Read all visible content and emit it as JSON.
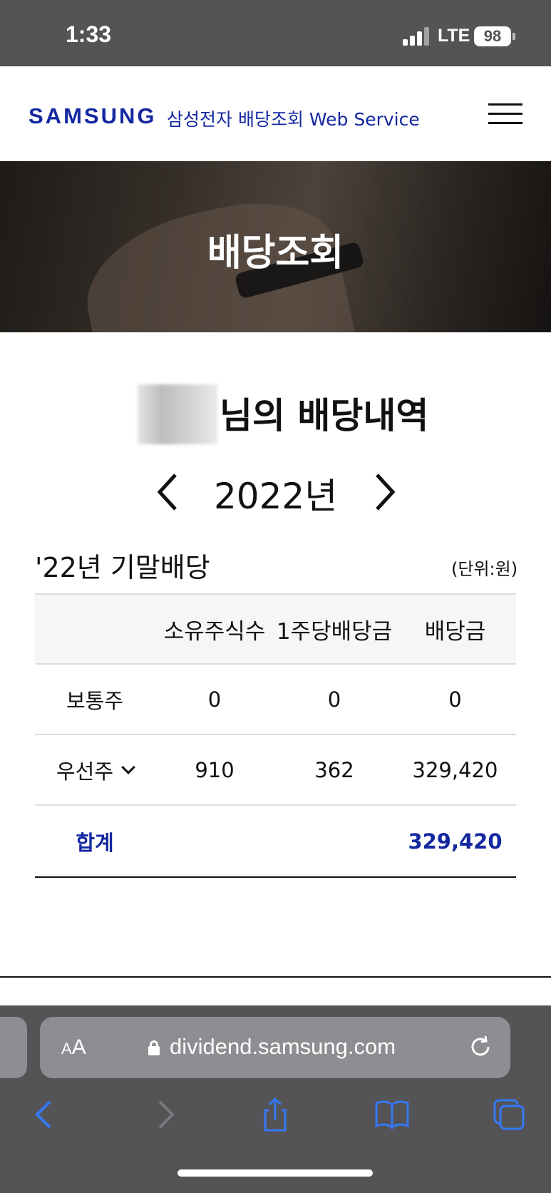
{
  "status_bar": {
    "time": "1:33",
    "network": "LTE",
    "battery": "98"
  },
  "header": {
    "logo": "SAMSUNG",
    "subtitle": "삼성전자 배당조회 Web Service",
    "menu_icon": "hamburger-menu-icon"
  },
  "hero": {
    "title": "배당조회"
  },
  "owner": {
    "suffix": "님의 배당내역"
  },
  "year_nav": {
    "year": "2022년",
    "prev_icon": "chevron-left-icon",
    "next_icon": "chevron-right-icon"
  },
  "section": {
    "title": "'22년 기말배당",
    "unit": "(단위:원)"
  },
  "table": {
    "headers": [
      "",
      "소유주식수",
      "1주당배당금",
      "배당금"
    ],
    "rows": [
      {
        "label": "보통주",
        "shares": "0",
        "per_share": "0",
        "dividend": "0"
      },
      {
        "label": "우선주",
        "shares": "910",
        "per_share": "362",
        "dividend": "329,420"
      }
    ],
    "total": {
      "label": "합계",
      "dividend": "329,420"
    }
  },
  "browser": {
    "text_size": "AA",
    "url": "dividend.samsung.com",
    "accent_color": "#3478f6"
  },
  "colors": {
    "brand": "#1428a0",
    "chrome": "#545456"
  }
}
